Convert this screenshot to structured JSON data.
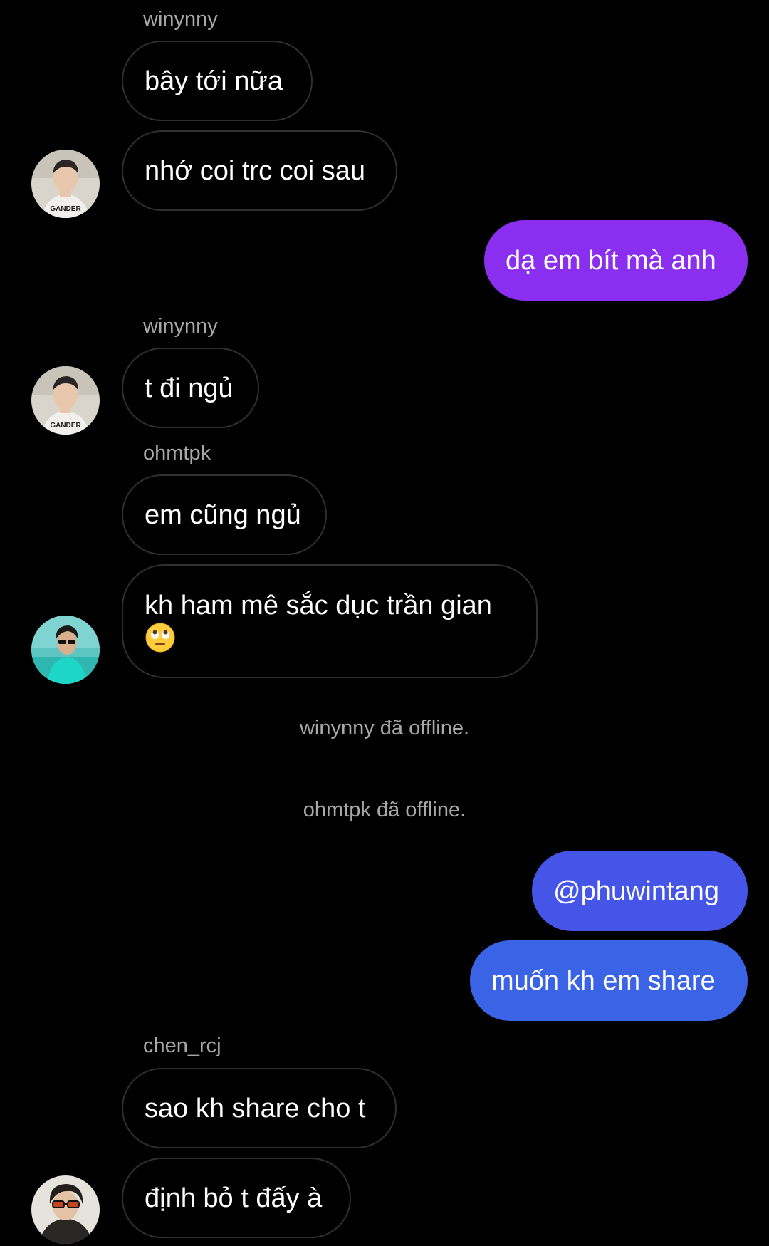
{
  "conversation": {
    "messages": [
      {
        "type": "incoming",
        "sender": "winynny",
        "text": "bây tới nữa"
      },
      {
        "type": "incoming",
        "sender": "winynny",
        "text": "nhớ coi trc coi sau"
      },
      {
        "type": "outgoing",
        "text": "dạ em bít mà anh",
        "color": "#8a2ff0"
      },
      {
        "type": "incoming",
        "sender": "winynny",
        "text": "t đi ngủ"
      },
      {
        "type": "incoming",
        "sender": "ohmtpk",
        "text": "em cũng ngủ"
      },
      {
        "type": "incoming",
        "sender": "ohmtpk",
        "text": "kh ham mê sắc dục trần gian",
        "emoji": "eye-roll-emoji"
      },
      {
        "type": "system",
        "text": "winynny đã offline."
      },
      {
        "type": "system",
        "text": "ohmtpk đã offline."
      },
      {
        "type": "outgoing",
        "text": "@phuwintang",
        "color": "#4455e8"
      },
      {
        "type": "outgoing",
        "text": "muốn kh em share",
        "color": "#3a63e6"
      },
      {
        "type": "incoming",
        "sender": "chen_rcj",
        "text": "sao kh share cho t"
      },
      {
        "type": "incoming",
        "sender": "chen_rcj",
        "text": "định bỏ t đấy à"
      }
    ],
    "sender_labels": [
      "winynny",
      "winynny",
      "ohmtpk",
      "chen_rcj"
    ]
  },
  "colors": {
    "background": "#000000",
    "incoming_border": "#303030",
    "sender_text": "#a8a8a8",
    "outgoing_purple": "#8a2ff0",
    "outgoing_blue_1": "#4455e8",
    "outgoing_blue_2": "#3a63e6"
  },
  "icons": {
    "avatar_winynny": "avatar-winynny",
    "avatar_ohmtpk": "avatar-ohmtpk",
    "avatar_chen": "avatar-chen-rcj",
    "emoji": "eye-roll-emoji"
  }
}
